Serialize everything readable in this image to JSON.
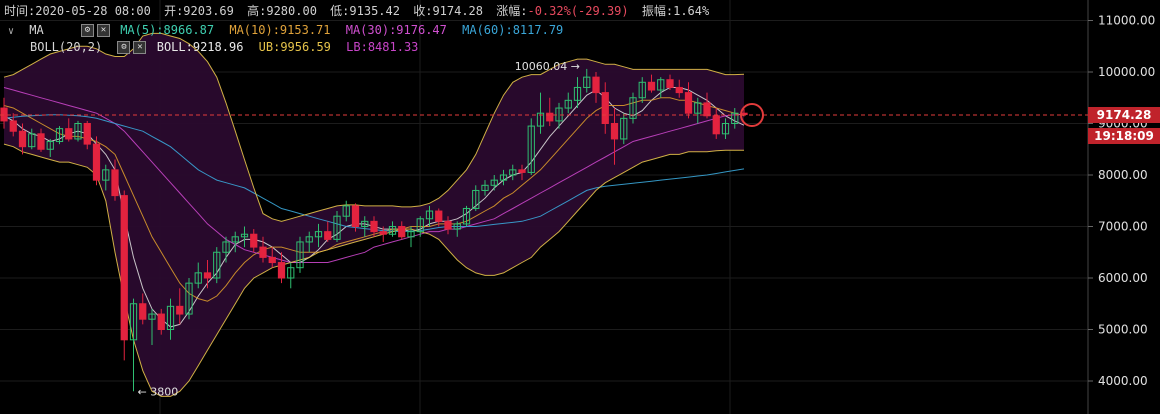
{
  "header": {
    "time_label": "时间:",
    "time": "2020-05-28 08:00",
    "open_label": "开:",
    "open": "9203.69",
    "high_label": "高:",
    "high": "9280.00",
    "low_label": "低:",
    "low": "9135.42",
    "close_label": "收:",
    "close": "9174.28",
    "change_label": "涨幅:",
    "change": "-0.32%(-29.39)",
    "amplitude_label": "振幅:",
    "amplitude": "1.64%"
  },
  "ma_legend": {
    "name": "MA",
    "ma5": "MA(5):8966.87",
    "ma10": "MA(10):9153.71",
    "ma30": "MA(30):9176.47",
    "ma60": "MA(60):8117.79"
  },
  "boll_legend": {
    "name": "BOLL(20,2)",
    "boll": "BOLL:9218.96",
    "ub": "UB:9956.59",
    "lb": "LB:8481.33"
  },
  "price_tag": {
    "price": "9174.28",
    "countdown": "19:18:09"
  },
  "annotations": {
    "high": "10060.04 →",
    "low": "← 3800"
  },
  "colors": {
    "up": "#2fbf71",
    "down": "#e3233f",
    "ma5": "#d9d9d9",
    "ma10": "#d99a2b",
    "ma30": "#c845c8",
    "ma60": "#3aa6d8",
    "boll_band": "#e5c34a",
    "boll_fill": "#2a0a2e",
    "price_line": "#e23b3b"
  },
  "chart_data": {
    "type": "candlestick",
    "ylim": [
      3700,
      11200
    ],
    "yticks": [
      "11000.00",
      "10000.00",
      "9000.00",
      "8000.00",
      "7000.00",
      "6000.00",
      "5000.00",
      "4000.00"
    ],
    "ytick_values": [
      11000,
      10000,
      9000,
      8000,
      7000,
      6000,
      5000,
      4000
    ],
    "candles": [
      [
        9300,
        9500,
        8900,
        9050
      ],
      [
        9050,
        9200,
        8750,
        8850
      ],
      [
        8850,
        9000,
        8400,
        8550
      ],
      [
        8550,
        8900,
        8500,
        8800
      ],
      [
        8800,
        8900,
        8450,
        8500
      ],
      [
        8500,
        8700,
        8350,
        8650
      ],
      [
        8650,
        8950,
        8600,
        8900
      ],
      [
        8900,
        9100,
        8650,
        8700
      ],
      [
        8700,
        9050,
        8650,
        9000
      ],
      [
        9000,
        9050,
        8500,
        8600
      ],
      [
        8600,
        8750,
        7800,
        7900
      ],
      [
        7900,
        8200,
        7700,
        8100
      ],
      [
        8100,
        8300,
        7500,
        7600
      ],
      [
        7600,
        7700,
        4400,
        4800
      ],
      [
        4800,
        5600,
        3800,
        5500
      ],
      [
        5500,
        5700,
        5100,
        5200
      ],
      [
        5200,
        5400,
        4700,
        5300
      ],
      [
        5300,
        5400,
        4900,
        5000
      ],
      [
        5000,
        5600,
        4800,
        5450
      ],
      [
        5450,
        5800,
        5100,
        5300
      ],
      [
        5300,
        6000,
        5200,
        5900
      ],
      [
        5900,
        6300,
        5800,
        6100
      ],
      [
        6100,
        6350,
        5800,
        6000
      ],
      [
        6000,
        6600,
        5900,
        6500
      ],
      [
        6500,
        6800,
        6300,
        6700
      ],
      [
        6700,
        6900,
        6500,
        6800
      ],
      [
        6800,
        7000,
        6600,
        6850
      ],
      [
        6850,
        6950,
        6500,
        6600
      ],
      [
        6600,
        6800,
        6300,
        6400
      ],
      [
        6400,
        6600,
        6200,
        6300
      ],
      [
        6300,
        6500,
        5900,
        6000
      ],
      [
        6000,
        6300,
        5800,
        6200
      ],
      [
        6200,
        6800,
        6100,
        6700
      ],
      [
        6700,
        6900,
        6500,
        6800
      ],
      [
        6800,
        7050,
        6600,
        6900
      ],
      [
        6900,
        7100,
        6700,
        6750
      ],
      [
        6750,
        7300,
        6700,
        7200
      ],
      [
        7200,
        7500,
        7100,
        7400
      ],
      [
        7400,
        7450,
        6900,
        7000
      ],
      [
        7000,
        7200,
        6800,
        7100
      ],
      [
        7100,
        7200,
        6800,
        6900
      ],
      [
        6900,
        7000,
        6700,
        6850
      ],
      [
        6850,
        7100,
        6800,
        7000
      ],
      [
        7000,
        7100,
        6750,
        6800
      ],
      [
        6800,
        7000,
        6600,
        6900
      ],
      [
        6900,
        7200,
        6800,
        7150
      ],
      [
        7150,
        7400,
        7000,
        7300
      ],
      [
        7300,
        7350,
        7000,
        7100
      ],
      [
        7100,
        7200,
        6850,
        6950
      ],
      [
        6950,
        7100,
        6800,
        7050
      ],
      [
        7050,
        7400,
        7000,
        7350
      ],
      [
        7350,
        7800,
        7300,
        7700
      ],
      [
        7700,
        7900,
        7600,
        7800
      ],
      [
        7800,
        8000,
        7700,
        7900
      ],
      [
        7900,
        8100,
        7800,
        8000
      ],
      [
        8000,
        8200,
        7900,
        8100
      ],
      [
        8100,
        8200,
        7900,
        8050
      ],
      [
        8050,
        9100,
        8000,
        8950
      ],
      [
        8950,
        9600,
        8800,
        9200
      ],
      [
        9200,
        9500,
        8950,
        9050
      ],
      [
        9050,
        9400,
        8900,
        9300
      ],
      [
        9300,
        9600,
        9200,
        9450
      ],
      [
        9450,
        9900,
        9300,
        9700
      ],
      [
        9700,
        10060,
        9600,
        9900
      ],
      [
        9900,
        10000,
        9400,
        9600
      ],
      [
        9600,
        9800,
        8800,
        9000
      ],
      [
        9000,
        9300,
        8200,
        8700
      ],
      [
        8700,
        9200,
        8600,
        9100
      ],
      [
        9100,
        9600,
        9000,
        9500
      ],
      [
        9500,
        9900,
        9400,
        9800
      ],
      [
        9800,
        9950,
        9600,
        9650
      ],
      [
        9650,
        9900,
        9500,
        9850
      ],
      [
        9850,
        9950,
        9650,
        9700
      ],
      [
        9700,
        9850,
        9500,
        9600
      ],
      [
        9600,
        9800,
        9100,
        9200
      ],
      [
        9200,
        9500,
        9000,
        9400
      ],
      [
        9400,
        9600,
        9100,
        9150
      ],
      [
        9150,
        9300,
        8700,
        8800
      ],
      [
        8800,
        9100,
        8700,
        9000
      ],
      [
        9000,
        9300,
        8900,
        9200
      ],
      [
        9200,
        9280,
        9135,
        9174
      ]
    ],
    "series": [
      {
        "key": "ma5",
        "values": [
          9150,
          9050,
          8900,
          8800,
          8750,
          8650,
          8700,
          8800,
          8850,
          8800,
          8600,
          8400,
          8100,
          7200,
          6400,
          5800,
          5400,
          5200,
          5050,
          5100,
          5350,
          5650,
          5900,
          6100,
          6400,
          6650,
          6750,
          6750,
          6700,
          6600,
          6450,
          6300,
          6300,
          6400,
          6550,
          6750,
          6850,
          7000,
          7050,
          7050,
          7000,
          6950,
          6950,
          6950,
          6900,
          6950,
          7050,
          7100,
          7100,
          7150,
          7250,
          7400,
          7550,
          7750,
          7900,
          8000,
          8050,
          8250,
          8500,
          8750,
          8950,
          9150,
          9350,
          9550,
          9650,
          9500,
          9300,
          9200,
          9150,
          9250,
          9450,
          9600,
          9700,
          9700,
          9650,
          9550,
          9450,
          9300,
          9150,
          9050,
          8967
        ]
      },
      {
        "key": "ma10",
        "values": [
          9350,
          9300,
          9200,
          9100,
          9000,
          8900,
          8800,
          8750,
          8750,
          8700,
          8650,
          8550,
          8400,
          8000,
          7600,
          7200,
          6800,
          6500,
          6200,
          5900,
          5700,
          5600,
          5550,
          5650,
          5850,
          6100,
          6300,
          6450,
          6550,
          6600,
          6600,
          6550,
          6500,
          6500,
          6500,
          6550,
          6650,
          6700,
          6750,
          6800,
          6850,
          6900,
          6950,
          6950,
          7000,
          7000,
          7000,
          7050,
          7050,
          7050,
          7100,
          7200,
          7300,
          7400,
          7550,
          7650,
          7800,
          7950,
          8100,
          8300,
          8500,
          8700,
          8900,
          9100,
          9250,
          9350,
          9350,
          9350,
          9400,
          9450,
          9450,
          9500,
          9500,
          9450,
          9450,
          9400,
          9350,
          9300,
          9250,
          9200,
          9154
        ]
      },
      {
        "key": "ma30",
        "values": [
          9700,
          9650,
          9600,
          9550,
          9500,
          9450,
          9400,
          9350,
          9300,
          9250,
          9200,
          9100,
          9000,
          8850,
          8650,
          8450,
          8250,
          8050,
          7850,
          7650,
          7450,
          7250,
          7050,
          6900,
          6750,
          6650,
          6550,
          6500,
          6450,
          6400,
          6350,
          6300,
          6300,
          6300,
          6300,
          6300,
          6350,
          6400,
          6450,
          6500,
          6600,
          6650,
          6700,
          6750,
          6800,
          6850,
          6900,
          6900,
          6950,
          6950,
          7000,
          7050,
          7100,
          7150,
          7250,
          7350,
          7450,
          7550,
          7650,
          7750,
          7850,
          7950,
          8050,
          8150,
          8250,
          8350,
          8450,
          8550,
          8650,
          8700,
          8750,
          8800,
          8850,
          8900,
          8950,
          9000,
          9050,
          9100,
          9150,
          9170,
          9176
        ]
      },
      {
        "key": "ma60",
        "values": [
          9100,
          9120,
          9140,
          9150,
          9160,
          9170,
          9170,
          9160,
          9150,
          9130,
          9100,
          9050,
          9000,
          8950,
          8900,
          8850,
          8750,
          8650,
          8550,
          8400,
          8250,
          8100,
          8000,
          7900,
          7850,
          7800,
          7750,
          7650,
          7550,
          7450,
          7350,
          7300,
          7250,
          7200,
          7150,
          7100,
          7050,
          7000,
          6980,
          6960,
          6940,
          6920,
          6910,
          6900,
          6910,
          6920,
          6950,
          6980,
          7000,
          7000,
          7000,
          7000,
          7020,
          7040,
          7060,
          7080,
          7100,
          7150,
          7200,
          7300,
          7400,
          7500,
          7600,
          7700,
          7750,
          7780,
          7800,
          7820,
          7840,
          7860,
          7880,
          7900,
          7920,
          7940,
          7960,
          7980,
          8000,
          8030,
          8060,
          8090,
          8118
        ]
      },
      {
        "key": "ub",
        "values": [
          9900,
          9950,
          10050,
          10150,
          10250,
          10350,
          10400,
          10450,
          10500,
          10500,
          10450,
          10350,
          10300,
          10300,
          10450,
          10700,
          10750,
          10750,
          10700,
          10650,
          10550,
          10400,
          10200,
          9900,
          9400,
          8850,
          8300,
          7750,
          7250,
          7150,
          7100,
          7150,
          7200,
          7250,
          7300,
          7350,
          7400,
          7420,
          7420,
          7400,
          7400,
          7400,
          7400,
          7380,
          7380,
          7400,
          7450,
          7550,
          7700,
          7900,
          8100,
          8400,
          8800,
          9200,
          9550,
          9800,
          9900,
          9950,
          9950,
          10050,
          10150,
          10200,
          10250,
          10250,
          10200,
          10150,
          10150,
          10100,
          10050,
          10050,
          10050,
          10050,
          10050,
          10050,
          10050,
          10050,
          10050,
          10000,
          9950,
          9950,
          9957
        ]
      },
      {
        "key": "lb",
        "values": [
          8600,
          8550,
          8450,
          8400,
          8350,
          8300,
          8250,
          8250,
          8200,
          8150,
          8000,
          7500,
          6500,
          5600,
          4800,
          4200,
          3800,
          3700,
          3700,
          3800,
          4000,
          4300,
          4600,
          4900,
          5200,
          5500,
          5800,
          6000,
          6100,
          6200,
          6250,
          6300,
          6350,
          6400,
          6500,
          6550,
          6600,
          6650,
          6700,
          6750,
          6800,
          6850,
          6900,
          6950,
          6950,
          6900,
          6850,
          6750,
          6550,
          6350,
          6200,
          6100,
          6050,
          6050,
          6100,
          6200,
          6300,
          6400,
          6600,
          6750,
          6900,
          7100,
          7300,
          7500,
          7700,
          7850,
          7950,
          8050,
          8150,
          8250,
          8300,
          8350,
          8400,
          8400,
          8450,
          8450,
          8450,
          8470,
          8480,
          8480,
          8481
        ]
      }
    ]
  }
}
